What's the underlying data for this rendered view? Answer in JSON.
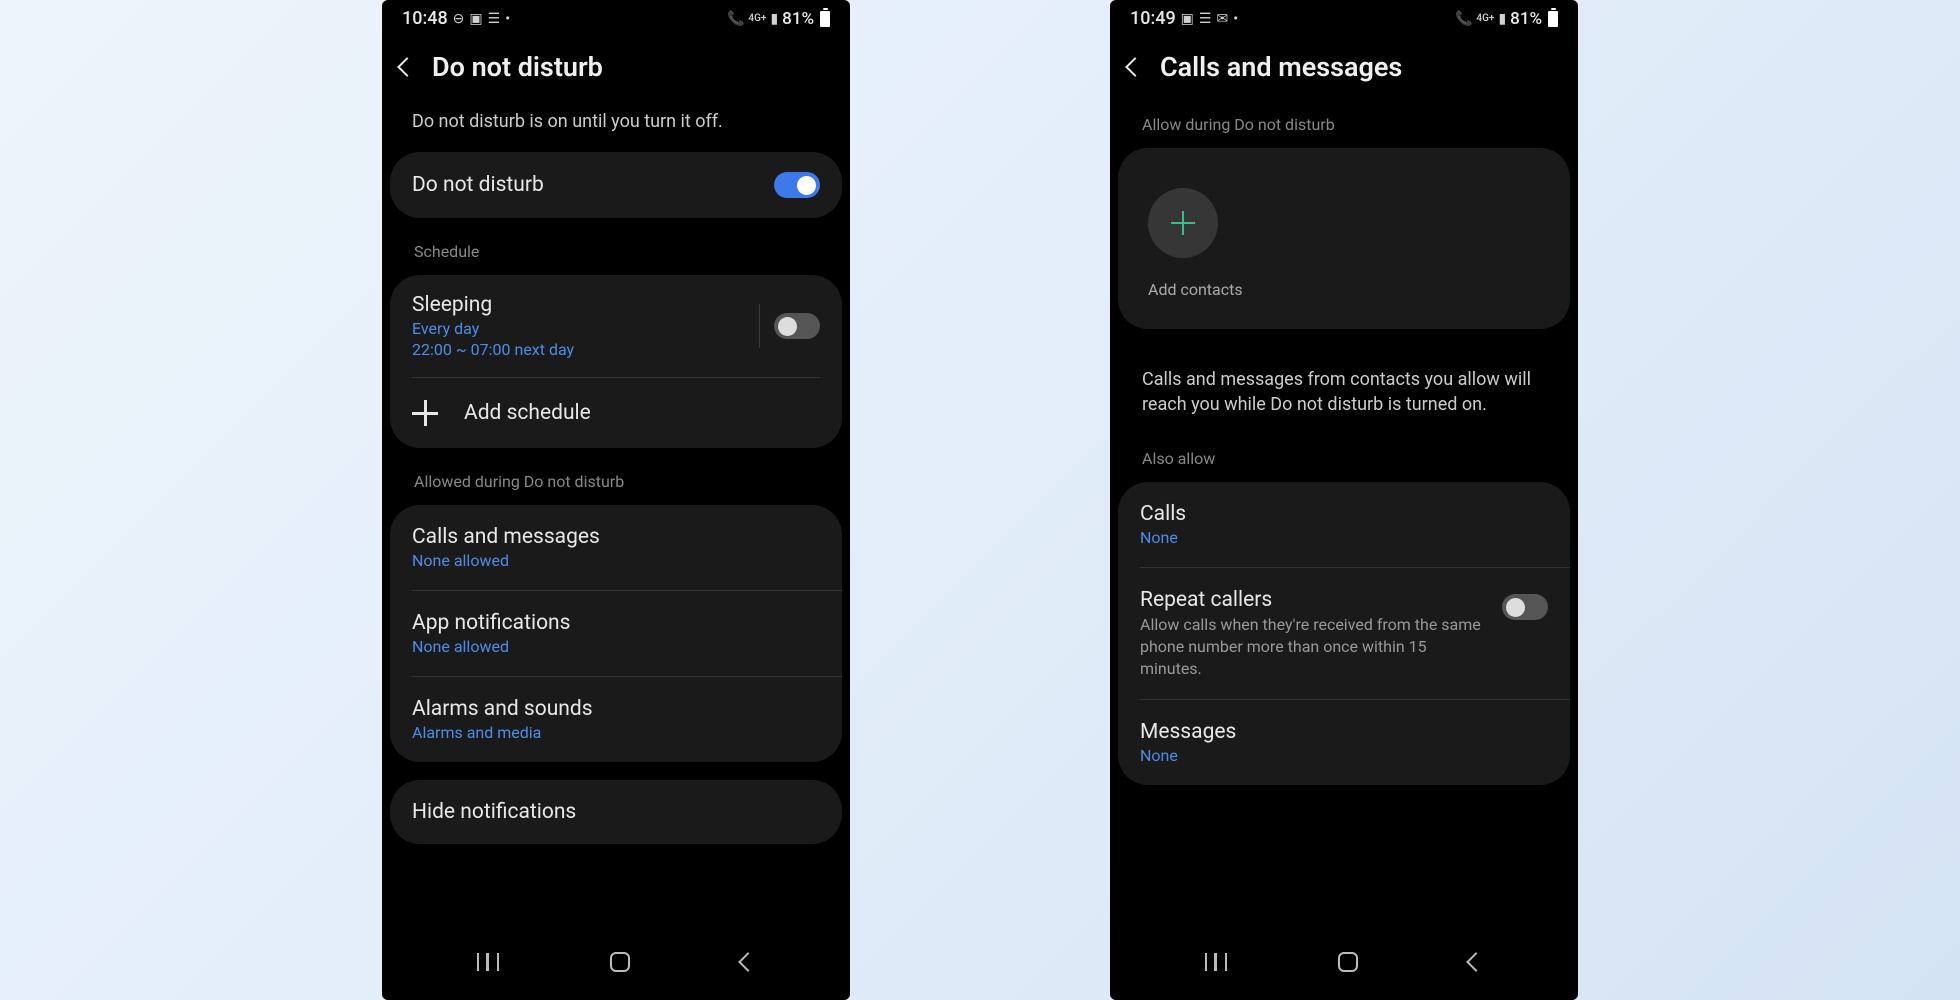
{
  "left": {
    "status": {
      "time": "10:48",
      "battery": "81%"
    },
    "title": "Do not disturb",
    "description": "Do not disturb is on until you turn it off.",
    "dnd_toggle_label": "Do not disturb",
    "section_schedule": "Schedule",
    "sleep": {
      "title": "Sleeping",
      "sub1": "Every day",
      "sub2": "22:00 ~ 07:00 next day"
    },
    "add_schedule": "Add schedule",
    "section_allowed": "Allowed during Do not disturb",
    "calls": {
      "title": "Calls and messages",
      "sub": "None allowed"
    },
    "apps": {
      "title": "App notifications",
      "sub": "None allowed"
    },
    "alarms": {
      "title": "Alarms and sounds",
      "sub": "Alarms and media"
    },
    "hide": "Hide notifications"
  },
  "right": {
    "status": {
      "time": "10:49",
      "battery": "81%"
    },
    "title": "Calls and messages",
    "section_allow": "Allow during Do not disturb",
    "add_contacts": "Add contacts",
    "explain": "Calls and messages from contacts you allow will reach you while Do not disturb is turned on.",
    "section_also": "Also allow",
    "calls": {
      "title": "Calls",
      "sub": "None"
    },
    "repeat": {
      "title": "Repeat callers",
      "sub": "Allow calls when they're received from the same phone number more than once within 15 minutes."
    },
    "messages": {
      "title": "Messages",
      "sub": "None"
    }
  }
}
